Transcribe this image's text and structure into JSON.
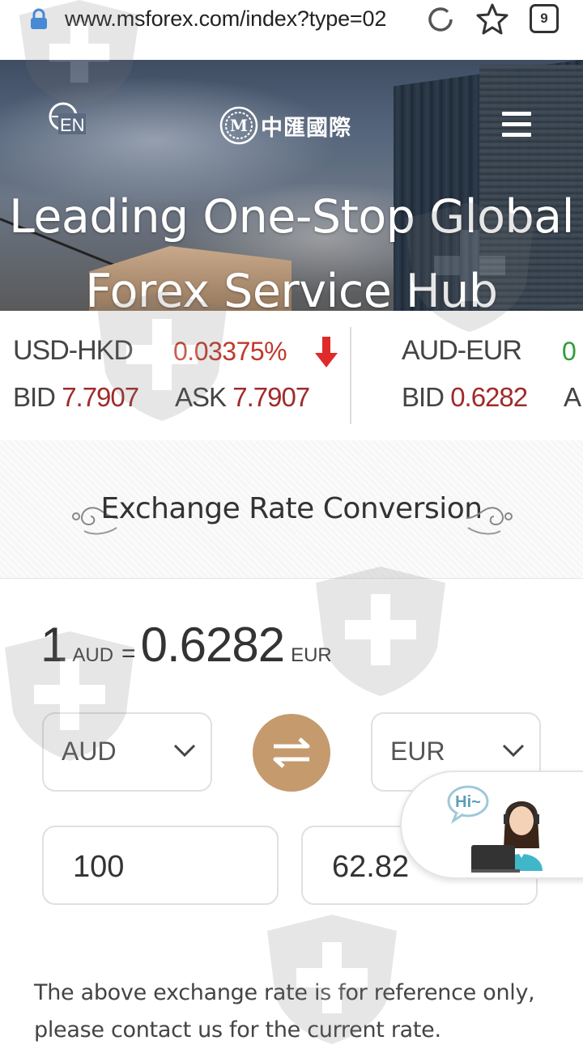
{
  "browser": {
    "url": "www.msforex.com/index?type=02",
    "tab_count": "9"
  },
  "header": {
    "language_label": "EN",
    "brand_name": "中匯國際",
    "hero_title_line1": "Leading One-Stop Global",
    "hero_title_line2": "Forex Service Hub"
  },
  "ticker": [
    {
      "pair": "USD-HKD",
      "change": "0.03375%",
      "direction": "down",
      "bid_label": "BID",
      "bid": "7.7907",
      "ask_label": "ASK",
      "ask": "7.7907"
    },
    {
      "pair": "AUD-EUR",
      "change": "0",
      "direction": "up",
      "bid_label": "BID",
      "bid": "0.6282",
      "ask_label": "A"
    }
  ],
  "converter": {
    "section_title": "Exchange Rate Conversion",
    "amount_unit": "1",
    "from_code": "AUD",
    "equals": "=",
    "rate": "0.6282",
    "to_code": "EUR",
    "from_select": "AUD",
    "to_select": "EUR",
    "from_value": "100",
    "to_value": "62.82",
    "disclaimer": "The above exchange rate is for reference only, please contact us for the current rate."
  },
  "chat": {
    "bubble_text": "Hi~"
  },
  "colors": {
    "accent_gold": "#c59a6d",
    "price_red": "#a12a2a",
    "change_red": "#c0392b",
    "change_green": "#2e9d3a"
  }
}
